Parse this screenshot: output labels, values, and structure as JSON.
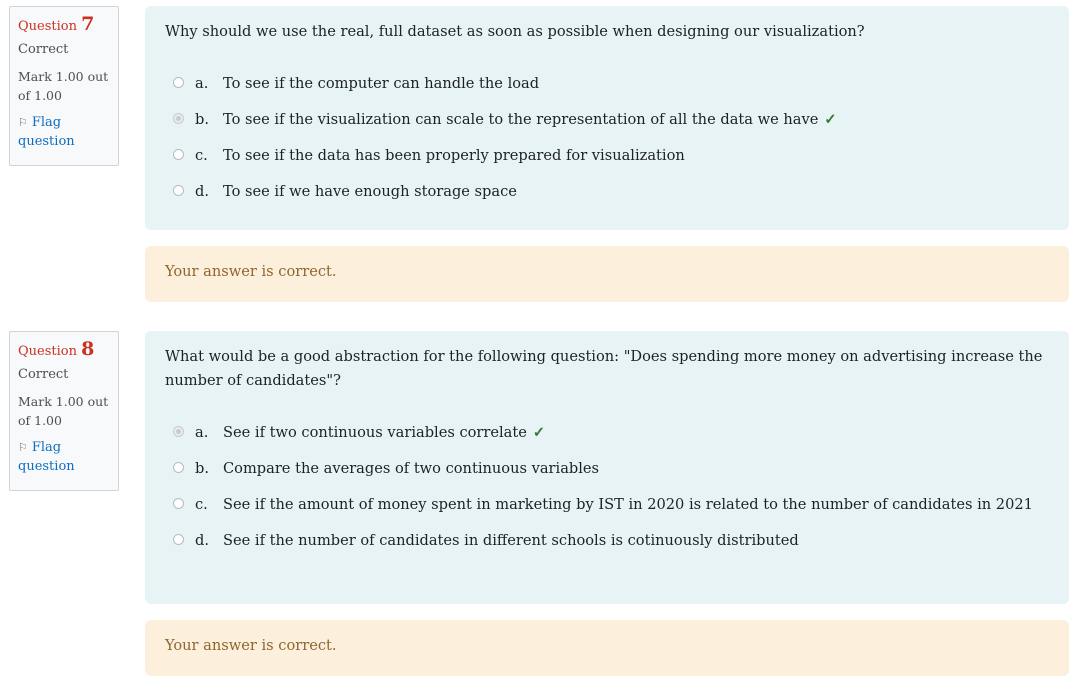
{
  "questions": [
    {
      "label": "Question",
      "number": "7",
      "state": "Correct",
      "grade": "Mark 1.00 out of 1.00",
      "flag_label": "Flag question",
      "text": "Why should we use the real, full dataset as soon as possible when designing our visualization?",
      "options": [
        {
          "letter": "a.",
          "text": "To see if the computer can handle the load",
          "selected": false,
          "correct": false
        },
        {
          "letter": "b.",
          "text": "To see if the visualization can scale to the representation of all the data we have",
          "selected": true,
          "correct": true
        },
        {
          "letter": "c.",
          "text": "To see if the data has been properly prepared for visualization",
          "selected": false,
          "correct": false
        },
        {
          "letter": "d.",
          "text": "To see if we have enough storage space",
          "selected": false,
          "correct": false
        }
      ],
      "feedback": "Your answer is correct."
    },
    {
      "label": "Question",
      "number": "8",
      "state": "Correct",
      "grade": "Mark 1.00 out of 1.00",
      "flag_label": "Flag question",
      "text": "What would be a good abstraction for the following question: \"Does spending more money on advertising increase the number of candidates\"?",
      "options": [
        {
          "letter": "a.",
          "text": "See if two continuous variables correlate",
          "selected": true,
          "correct": true
        },
        {
          "letter": "b.",
          "text": "Compare the averages of two continuous variables",
          "selected": false,
          "correct": false
        },
        {
          "letter": "c.",
          "text": "See if the amount of money spent in marketing by IST in 2020 is related to the number of candidates in 2021",
          "selected": false,
          "correct": false
        },
        {
          "letter": "d.",
          "text": "See if the number of candidates in different schools is cotinuously distributed",
          "selected": false,
          "correct": false
        }
      ],
      "feedback": "Your answer is correct."
    }
  ],
  "icons": {
    "flag": "flag-icon",
    "check": "check-icon",
    "check_glyph": "✓",
    "flag_glyph": "⚐"
  },
  "colors": {
    "question_number": "#ca3120",
    "correct_check": "#357a32",
    "formulation_bg": "#e7f3f5",
    "feedback_bg": "#fcefdc",
    "link": "#0f6cbf"
  }
}
